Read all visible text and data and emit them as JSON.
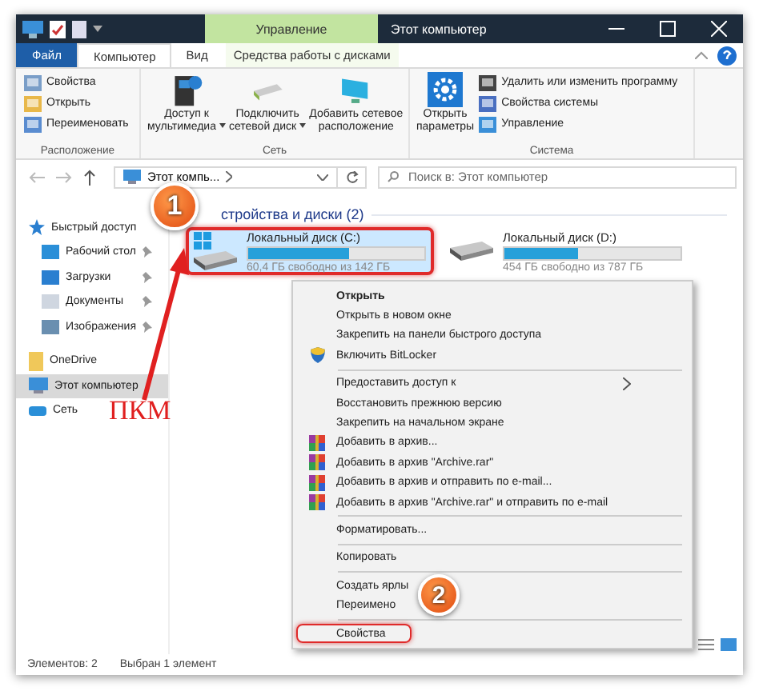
{
  "title_bar": {
    "context_tab": "Управление",
    "title": "Этот компьютер"
  },
  "ribbon_tabs": [
    {
      "label": "Файл",
      "kind": "file",
      "selected": false
    },
    {
      "label": "Компьютер",
      "kind": "tab",
      "selected": true
    },
    {
      "label": "Вид",
      "kind": "tab",
      "selected": false
    },
    {
      "label": "Средства работы с дисками",
      "kind": "context",
      "selected": false
    }
  ],
  "ribbon_groups": [
    {
      "name": "Расположение",
      "items": [
        {
          "label": "Свойства",
          "kind": "small"
        },
        {
          "label": "Открыть",
          "kind": "small"
        },
        {
          "label": "Переименовать",
          "kind": "small"
        }
      ]
    },
    {
      "name": "Сеть",
      "items": [
        {
          "label": "Доступ к\nмультимедиа",
          "kind": "large",
          "dropdown": true
        },
        {
          "label": "Подключить\nсетевой диск",
          "kind": "large",
          "dropdown": true
        },
        {
          "label": "Добавить сетевое\nрасположение",
          "kind": "large",
          "dropdown": false
        }
      ]
    },
    {
      "name": "Система",
      "items": [
        {
          "label": "Открыть\nпараметры",
          "kind": "large",
          "dropdown": false
        },
        {
          "label": "Удалить или изменить программу",
          "kind": "small"
        },
        {
          "label": "Свойства системы",
          "kind": "small"
        },
        {
          "label": "Управление",
          "kind": "small"
        }
      ]
    }
  ],
  "address": {
    "path": "Этот компь...",
    "search_placeholder": "Поиск в: Этот компьютер"
  },
  "sidebar": {
    "items": [
      {
        "label": "Быстрый доступ",
        "selected": false,
        "children": [
          {
            "label": "Рабочий стол",
            "pinned": true,
            "selected": false
          },
          {
            "label": "Загрузки",
            "pinned": true,
            "selected": false
          },
          {
            "label": "Документы",
            "pinned": true,
            "selected": false
          },
          {
            "label": "Изображения",
            "pinned": true,
            "selected": false
          }
        ]
      },
      {
        "label": "OneDrive",
        "selected": false
      },
      {
        "label": "Этот компьютер",
        "selected": true
      },
      {
        "label": "Сеть",
        "selected": false
      }
    ]
  },
  "section_title": "стройства и диски (2)",
  "drives": [
    {
      "name": "Локальный диск (C:)",
      "free": "60,4 ГБ свободно из 142 ГБ",
      "level": 0.57,
      "system": true,
      "selected": true,
      "highlighted": true
    },
    {
      "name": "Локальный диск (D:)",
      "free": "454 ГБ свободно из 787 ГБ",
      "level": 0.42,
      "system": false,
      "selected": false,
      "highlighted": false
    }
  ],
  "context_menu": {
    "items": [
      {
        "kind": "plain",
        "label": "Открыть",
        "default": true,
        "highlighted": false
      },
      {
        "kind": "plain",
        "label": "Открыть в новом окне",
        "default": false,
        "highlighted": false
      },
      {
        "kind": "plain",
        "label": "Закрепить на панели быстрого доступа",
        "default": false,
        "highlighted": false
      },
      {
        "kind": "shield",
        "label": "Включить BitLocker",
        "default": false,
        "highlighted": false
      },
      {
        "kind": "separator"
      },
      {
        "kind": "submenu",
        "label": "Предоставить доступ к",
        "default": false,
        "highlighted": false
      },
      {
        "kind": "plain",
        "label": "Восстановить прежнюю версию",
        "default": false,
        "highlighted": false
      },
      {
        "kind": "plain",
        "label": "Закрепить на начальном экране",
        "default": false,
        "highlighted": false
      },
      {
        "kind": "archive",
        "label": "Добавить в архив...",
        "default": false,
        "highlighted": false
      },
      {
        "kind": "archive",
        "label": "Добавить в архив \"Archive.rar\"",
        "default": false,
        "highlighted": false
      },
      {
        "kind": "archive",
        "label": "Добавить в архив и отправить по e-mail...",
        "default": false,
        "highlighted": false
      },
      {
        "kind": "archive",
        "label": "Добавить в архив \"Archive.rar\" и отправить по e-mail",
        "default": false,
        "highlighted": false
      },
      {
        "kind": "separator"
      },
      {
        "kind": "plain",
        "label": "Форматировать...",
        "default": false,
        "highlighted": false
      },
      {
        "kind": "separator"
      },
      {
        "kind": "plain",
        "label": "Копировать",
        "default": false,
        "highlighted": false
      },
      {
        "kind": "separator"
      },
      {
        "kind": "plain",
        "label": "Создать ярлы",
        "default": false,
        "highlighted": false
      },
      {
        "kind": "plain",
        "label": "Переимено",
        "default": false,
        "highlighted": false
      },
      {
        "kind": "separator"
      },
      {
        "kind": "plain",
        "label": "Свойства",
        "default": false,
        "highlighted": true
      }
    ]
  },
  "annotations": [
    {
      "kind": "badge",
      "label": "1"
    },
    {
      "kind": "badge",
      "label": "2"
    },
    {
      "kind": "caption",
      "label": "ПКМ"
    }
  ],
  "status_bar": [
    "Элементов: 2",
    "Выбран 1 элемент"
  ]
}
